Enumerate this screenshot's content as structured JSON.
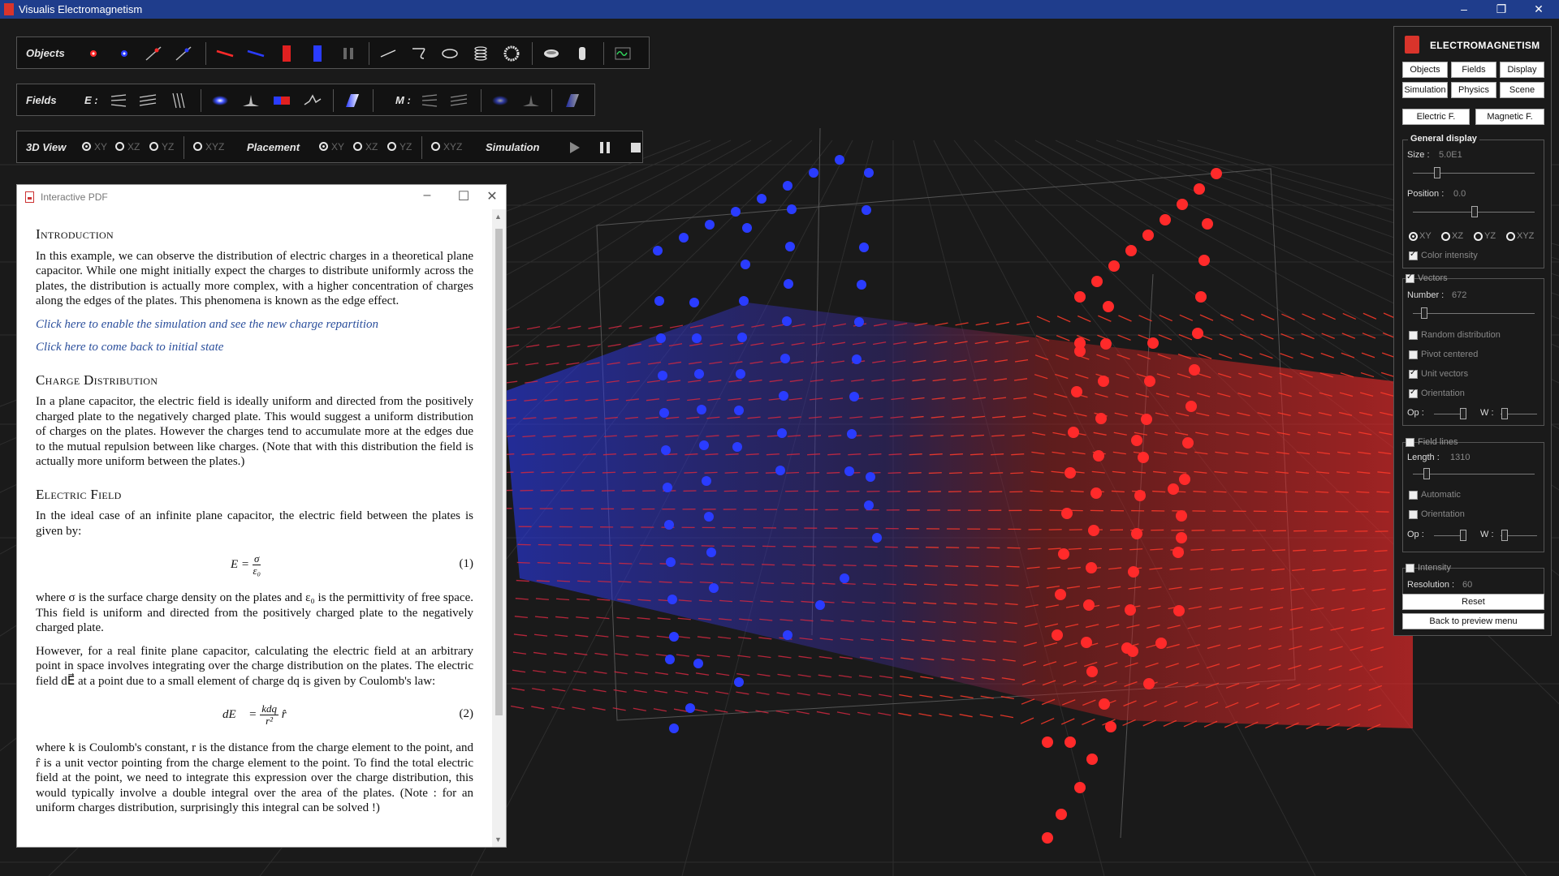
{
  "window": {
    "title": "Visualis Electromagnetism",
    "minimize": "–",
    "restore": "❐",
    "close": "✕"
  },
  "toolbar_objects": {
    "label": "Objects"
  },
  "toolbar_fields": {
    "label": "Fields",
    "e_label": "E :",
    "m_label": "M :"
  },
  "toolbar_view": {
    "view_label": "3D View",
    "view_options": [
      "XY",
      "XZ",
      "YZ",
      "XYZ"
    ],
    "placement_label": "Placement",
    "placement_options": [
      "XY",
      "XZ",
      "YZ",
      "XYZ"
    ],
    "simulation_label": "Simulation"
  },
  "pdf": {
    "window_title": "Interactive PDF",
    "h1": "Introduction",
    "p1": "In this example, we can observe the distribution of electric charges in a theoretical plane capacitor. While one might initially expect the charges to distribute uniformly across the plates, the distribution is actually more complex, with a higher concentration of charges along the edges of the plates. This phenomena is known as the edge effect.",
    "link1": "Click here to enable the simulation and see the new charge repartition",
    "link2": "Click here to come back to initial state",
    "h2": "Charge Distribution",
    "p2": "In a plane capacitor, the electric field is ideally uniform and directed from the positively charged plate to the negatively charged plate. This would suggest a uniform distribution of charges on the plates. However the charges tend to accumulate more at the edges due to the mutual repulsion between like charges. (Note that with this distribution the field is actually more uniform between the plates.)",
    "h3": "Electric Field",
    "p3": "In the ideal case of an infinite plane capacitor, the electric field between the plates is given by:",
    "eq1_lhs": "E =",
    "eq1_num": "σ",
    "eq1_den": "ε₀",
    "eq1_no": "(1)",
    "p4": "where σ is the surface charge density on the plates and ε₀ is the permittivity of free space. This field is uniform and directed from the positively charged plate to the negatively charged plate.",
    "p5": "However, for a real finite plane capacitor, calculating the electric field at an arbitrary point in space involves integrating over the charge distribution on the plates. The electric field dE⃗ at a point due to a small element of charge dq is given by Coulomb's law:",
    "eq2_lhs": "dE⃗ =",
    "eq2_num": "kdq",
    "eq2_den": "r²",
    "eq2_rhat": "r̂",
    "eq2_no": "(2)",
    "p6": "where k is Coulomb's constant, r is the distance from the charge element to the point, and r̂ is a unit vector pointing from the charge element to the point. To find the total electric field at the point, we need to integrate this expression over the charge distribution, this would typically involve a double integral over the area of the plates. (Note : for an uniform charges distribution, surprisingly this integral can be solved !)"
  },
  "panel": {
    "brand": "ELECTROMAGNETISM",
    "tabs_row1": [
      "Objects",
      "Fields",
      "Display"
    ],
    "tabs_row2": [
      "Simulation",
      "Physics",
      "Scene"
    ],
    "field_tabs": [
      "Electric F.",
      "Magnetic F."
    ],
    "general": {
      "title": "General display",
      "size_label": "Size :",
      "size_value": "5.0E1",
      "position_label": "Position :",
      "position_value": "0.0",
      "planes": [
        "XY",
        "XZ",
        "YZ",
        "XYZ"
      ],
      "color_intensity": "Color intensity"
    },
    "vectors": {
      "title": "Vectors",
      "number_label": "Number :",
      "number_value": "672",
      "random": "Random distribution",
      "pivot": "Pivot centered",
      "unit": "Unit vectors",
      "orientation": "Orientation",
      "op": "Op :",
      "w": "W :"
    },
    "fieldlines": {
      "title": "Field lines",
      "length_label": "Length :",
      "length_value": "1310",
      "automatic": "Automatic",
      "orientation": "Orientation",
      "op": "Op :",
      "w": "W :"
    },
    "intensity": {
      "title": "Intensity",
      "resolution_label": "Resolution :",
      "resolution_value": "60"
    },
    "reset": "Reset",
    "back": "Back to preview menu"
  },
  "colors": {
    "titlebar": "#1f3d8c",
    "positive": "#ff2a2a",
    "negative": "#2a3cff",
    "link": "#2b4f9c"
  }
}
